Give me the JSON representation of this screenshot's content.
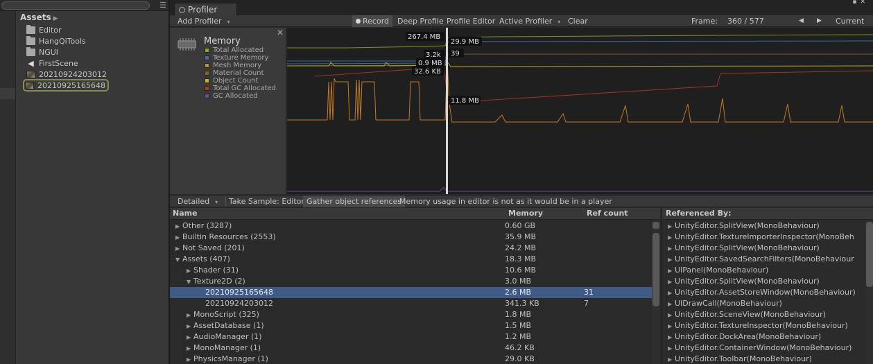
{
  "project": {
    "assets_title": "Assets",
    "items": [
      {
        "label": "Editor",
        "icon": "folder-icon"
      },
      {
        "label": "HangQiTools",
        "icon": "folder-icon"
      },
      {
        "label": "NGUI",
        "icon": "folder-icon"
      },
      {
        "label": "FirstScene",
        "icon": "unity-scene-icon"
      },
      {
        "label": "20210924203012",
        "icon": "texture-thumbnail-icon"
      },
      {
        "label": "20210925165648",
        "icon": "texture-thumbnail-icon",
        "selected": true
      }
    ]
  },
  "window": {
    "tab_title": "Profiler"
  },
  "toolbar": {
    "add_profiler": "Add Profiler",
    "record": "Record",
    "deep_profile": "Deep Profile",
    "profile_editor": "Profile Editor",
    "active_profiler": "Active Profiler",
    "clear": "Clear",
    "frame_label": "Frame:",
    "frame_value": "360 / 577",
    "prev": "◀",
    "next": "▶",
    "current": "Current"
  },
  "legend": {
    "title": "Memory",
    "items": [
      {
        "label": "Total Allocated",
        "color": "#8fa81c"
      },
      {
        "label": "Texture Memory",
        "color": "#3f6fa0"
      },
      {
        "label": "Mesh Memory",
        "color": "#c8882c"
      },
      {
        "label": "Material Count",
        "color": "#7d6e1e"
      },
      {
        "label": "Object Count",
        "color": "#c9b81c"
      },
      {
        "label": "Total GC Allocated",
        "color": "#b43a26"
      },
      {
        "label": "GC Allocated",
        "color": "#6c4a8c"
      }
    ]
  },
  "chart_data": {
    "type": "line",
    "selected_frame": 360,
    "selected_values": [
      {
        "label": "267.4 MB",
        "series": "Total Allocated"
      },
      {
        "label": "29.9 MB",
        "series": "Texture Memory"
      },
      {
        "label": "3.2k",
        "series": "Object Count"
      },
      {
        "label": "39",
        "series": "Material Count"
      },
      {
        "label": "0.9 MB",
        "series": "Mesh Memory"
      },
      {
        "label": "32.6 KB",
        "series": "GC Allocated"
      },
      {
        "label": "11.8 MB",
        "series": "Total GC Allocated"
      }
    ]
  },
  "detail": {
    "mode": "Detailed",
    "take_sample": "Take Sample: Editor",
    "gather": "Gather object references",
    "note": "Memory usage in editor is not as it would be in a player"
  },
  "table": {
    "headers": {
      "name": "Name",
      "memory": "Memory",
      "refcount": "Ref count"
    },
    "rows": [
      {
        "name": "Other (3287)",
        "memory": "0.60 GB",
        "ref": "",
        "depth": 0,
        "tri": "right"
      },
      {
        "name": "Builtin Resources (2553)",
        "memory": "35.9 MB",
        "ref": "",
        "depth": 0,
        "tri": "right"
      },
      {
        "name": "Not Saved (201)",
        "memory": "24.2 MB",
        "ref": "",
        "depth": 0,
        "tri": "right"
      },
      {
        "name": "Assets (407)",
        "memory": "18.3 MB",
        "ref": "",
        "depth": 0,
        "tri": "down"
      },
      {
        "name": "Shader (31)",
        "memory": "10.6 MB",
        "ref": "",
        "depth": 1,
        "tri": "right"
      },
      {
        "name": "Texture2D (2)",
        "memory": "3.0 MB",
        "ref": "",
        "depth": 1,
        "tri": "down"
      },
      {
        "name": "20210925165648",
        "memory": "2.6 MB",
        "ref": "31",
        "depth": 2,
        "tri": "",
        "selected": true
      },
      {
        "name": "20210924203012",
        "memory": "341.3 KB",
        "ref": "7",
        "depth": 2,
        "tri": ""
      },
      {
        "name": "MonoScript (325)",
        "memory": "1.8 MB",
        "ref": "",
        "depth": 1,
        "tri": "right"
      },
      {
        "name": "AssetDatabase (1)",
        "memory": "1.5 MB",
        "ref": "",
        "depth": 1,
        "tri": "right"
      },
      {
        "name": "AudioManager (1)",
        "memory": "1.2 MB",
        "ref": "",
        "depth": 1,
        "tri": "right"
      },
      {
        "name": "MonoManager (1)",
        "memory": "46.2 KB",
        "ref": "",
        "depth": 1,
        "tri": "right"
      },
      {
        "name": "PhysicsManager (1)",
        "memory": "29.0 KB",
        "ref": "",
        "depth": 1,
        "tri": "right"
      }
    ]
  },
  "referenced_by": {
    "title": "Referenced By:",
    "items": [
      "UnityEditor.SplitView(MonoBehaviour)",
      "UnityEditor.TextureImporterInspector(MonoBeh",
      "UnityEditor.SplitView(MonoBehaviour)",
      "UnityEditor.SavedSearchFilters(MonoBehaviour",
      "UIPanel(MonoBehaviour)",
      "UnityEditor.SplitView(MonoBehaviour)",
      "UnityEditor.AssetStoreWindow(MonoBehaviour)",
      "UIDrawCall(MonoBehaviour)",
      "UnityEditor.SceneView(MonoBehaviour)",
      "UnityEditor.TextureInspector(MonoBehaviour)",
      "UnityEditor.DockArea(MonoBehaviour)",
      "UnityEditor.ContainerWindow(MonoBehaviour)",
      "UnityEditor.Toolbar(MonoBehaviour)"
    ]
  }
}
